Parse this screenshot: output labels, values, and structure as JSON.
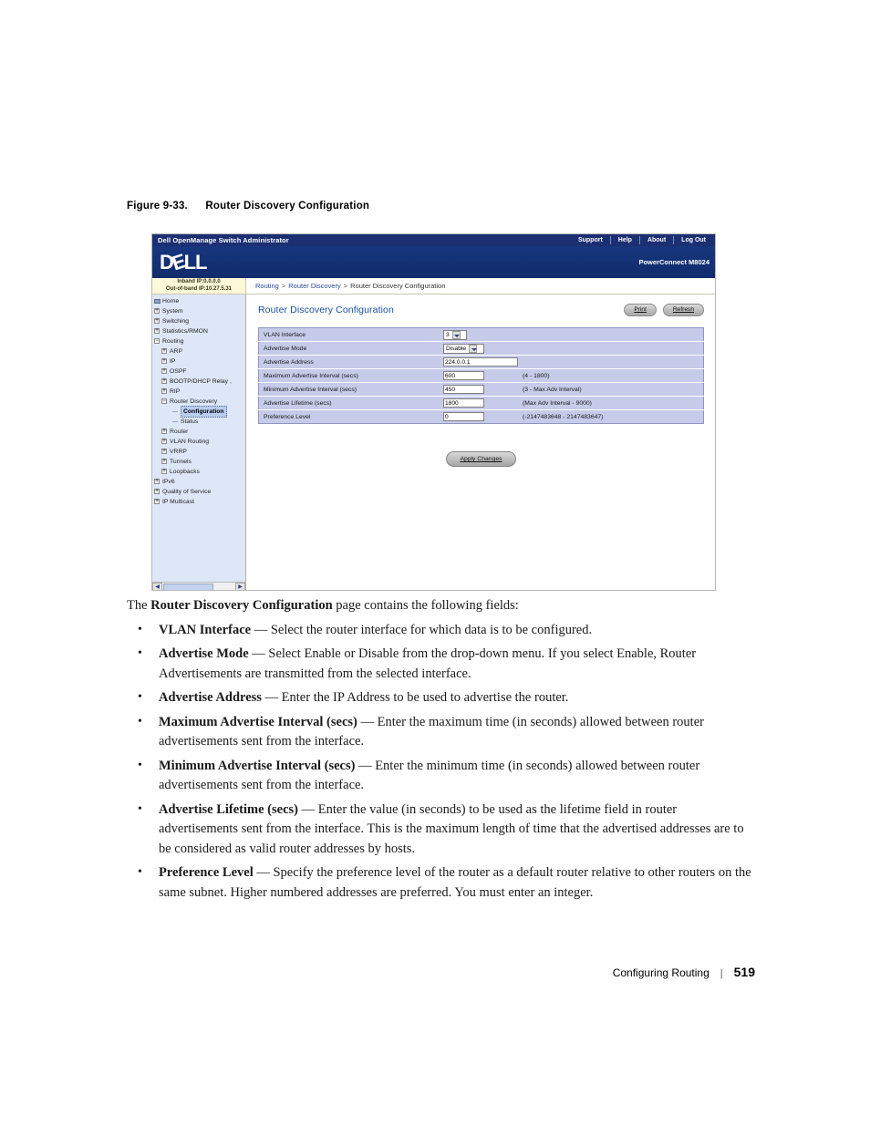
{
  "figure": {
    "number": "Figure 9-33.",
    "title": "Router Discovery Configuration"
  },
  "screenshot": {
    "topbar": {
      "app_title": "Dell OpenManage Switch Administrator",
      "links": [
        "Support",
        "Help",
        "About",
        "Log Out"
      ]
    },
    "logo_band": {
      "logo_text": "DELL",
      "model": "PowerConnect M8024"
    },
    "ip_box": {
      "inband": "Inband IP:0.0.0.0",
      "out_of_band": "Out-of-band IP:10.27.5.31"
    },
    "breadcrumb": {
      "items": [
        "Routing",
        "Router Discovery",
        "Router Discovery Configuration"
      ],
      "separator": ">"
    },
    "sidebar": {
      "items": [
        {
          "label": "Home",
          "level": 1,
          "marker": "doc",
          "selected": false
        },
        {
          "label": "System",
          "level": 1,
          "marker": "plus",
          "selected": false
        },
        {
          "label": "Switching",
          "level": 1,
          "marker": "plus",
          "selected": false
        },
        {
          "label": "Statistics/RMON",
          "level": 1,
          "marker": "plus",
          "selected": false
        },
        {
          "label": "Routing",
          "level": 1,
          "marker": "minus",
          "selected": false
        },
        {
          "label": "ARP",
          "level": 2,
          "marker": "plus",
          "selected": false
        },
        {
          "label": "IP",
          "level": 2,
          "marker": "plus",
          "selected": false
        },
        {
          "label": "OSPF",
          "level": 2,
          "marker": "plus",
          "selected": false
        },
        {
          "label": "BOOTP/DHCP Relay ,",
          "level": 2,
          "marker": "plus",
          "selected": false
        },
        {
          "label": "RIP",
          "level": 2,
          "marker": "plus",
          "selected": false
        },
        {
          "label": "Router Discovery",
          "level": 2,
          "marker": "minus",
          "selected": false
        },
        {
          "label": "Configuration",
          "level": 3,
          "marker": "leaf",
          "selected": true
        },
        {
          "label": "Status",
          "level": 3,
          "marker": "leaf",
          "selected": false
        },
        {
          "label": "Router",
          "level": 2,
          "marker": "plus",
          "selected": false
        },
        {
          "label": "VLAN Routing",
          "level": 2,
          "marker": "plus",
          "selected": false
        },
        {
          "label": "VRRP",
          "level": 2,
          "marker": "plus",
          "selected": false
        },
        {
          "label": "Tunnels",
          "level": 2,
          "marker": "plus",
          "selected": false
        },
        {
          "label": "Loopbacks",
          "level": 2,
          "marker": "plus",
          "selected": false
        },
        {
          "label": "IPv6",
          "level": 1,
          "marker": "plus",
          "selected": false
        },
        {
          "label": "Quality of Service",
          "level": 1,
          "marker": "plus",
          "selected": false
        },
        {
          "label": "IP Multicast",
          "level": 1,
          "marker": "plus",
          "selected": false
        }
      ]
    },
    "page": {
      "title": "Router Discovery Configuration",
      "print_label": "Print",
      "refresh_label": "Refresh",
      "apply_label": "Apply Changes",
      "fields": [
        {
          "label": "VLAN Interface",
          "type": "select",
          "value": "3",
          "hint": ""
        },
        {
          "label": "Advertise Mode",
          "type": "select",
          "value": "Disable",
          "hint": ""
        },
        {
          "label": "Advertise Address",
          "type": "text",
          "value": "224.0.0.1",
          "hint": ""
        },
        {
          "label": "Maximum Advertise Interval (secs)",
          "type": "text",
          "value": "600",
          "hint": "(4 - 1800)"
        },
        {
          "label": "Minimum Advertise Interval (secs)",
          "type": "text",
          "value": "450",
          "hint": "(3 - Max Adv Interval)"
        },
        {
          "label": "Advertise Lifetime (secs)",
          "type": "text",
          "value": "1800",
          "hint": "(Max Adv Interval - 9000)"
        },
        {
          "label": "Preference Level",
          "type": "text",
          "value": "0",
          "hint": "(-2147483648 - 2147483647)"
        }
      ]
    }
  },
  "prose": {
    "intro_before": "The ",
    "intro_bold": "Router Discovery Configuration",
    "intro_after": " page contains the following fields:",
    "bullets": [
      {
        "term": "VLAN Interface",
        "text": " — Select the router interface for which data is to be configured."
      },
      {
        "term": "Advertise Mode",
        "text": " — Select Enable or Disable from the drop-down menu. If you select Enable, Router Advertisements are transmitted from the selected interface."
      },
      {
        "term": "Advertise Address",
        "text": " — Enter the IP Address to be used to advertise the router."
      },
      {
        "term": "Maximum Advertise Interval (secs)",
        "text": " — Enter the maximum time (in seconds) allowed between router advertisements sent from the interface."
      },
      {
        "term": "Minimum Advertise Interval (secs)",
        "text": " — Enter the minimum time (in seconds) allowed between router advertisements sent from the interface."
      },
      {
        "term": "Advertise Lifetime (secs)",
        "text": " — Enter the value (in seconds) to be used as the lifetime field in router advertisements sent from the interface. This is the maximum length of time that the advertised addresses are to be considered as valid router addresses by hosts."
      },
      {
        "term": "Preference Level",
        "text": " — Specify the preference level of the router as a default router relative to other routers on the same subnet. Higher numbered addresses are preferred. You must enter an integer."
      }
    ]
  },
  "footer": {
    "chapter": "Configuring Routing",
    "separator": "|",
    "page_number": "519"
  },
  "colors": {
    "header_blue": "#14357f",
    "topbar_blue": "#1b2f72",
    "sidebar_blue": "#dee7f7",
    "form_lavender": "#c6cbe9",
    "title_blue": "#1a4fa0",
    "ipbox_yellow": "#fdf8d8"
  }
}
